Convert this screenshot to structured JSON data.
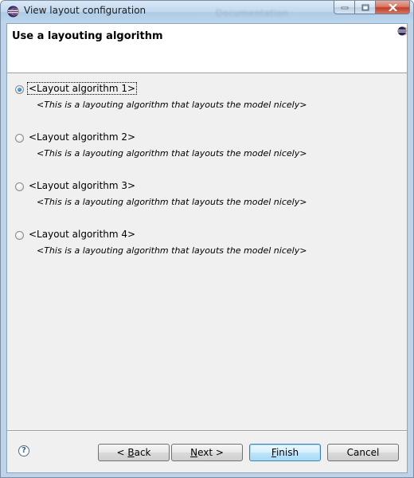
{
  "window": {
    "title": "View layout configuration",
    "ghost_title": "Documentation"
  },
  "header": {
    "title": "Use a layouting algorithm"
  },
  "options": [
    {
      "label": "<Layout algorithm 1>",
      "description": "<This is a layouting algorithm that layouts the model nicely>",
      "selected": true
    },
    {
      "label": "<Layout algorithm 2>",
      "description": "<This is a layouting algorithm that layouts the model nicely>",
      "selected": false
    },
    {
      "label": "<Layout algorithm 3>",
      "description": "<This is a layouting algorithm that layouts the model nicely>",
      "selected": false
    },
    {
      "label": "<Layout algorithm 4>",
      "description": "<This is a layouting algorithm that layouts the model nicely>",
      "selected": false
    }
  ],
  "buttons": {
    "help": "?",
    "back_prefix": "< ",
    "back_mnemonic": "B",
    "back_rest": "ack",
    "next_mnemonic": "N",
    "next_rest": "ext >",
    "finish_mnemonic": "F",
    "finish_rest": "inish",
    "cancel": "Cancel"
  },
  "colors": {
    "titlebar": "#c2d8ee",
    "dialog_bg": "#f0f0f0",
    "default_button": "#bee6fd",
    "close_button": "#c2402a"
  },
  "icons": {
    "app": "eclipse-icon",
    "header": "eclipse-small-icon",
    "minimize": "minimize-icon",
    "maximize": "maximize-icon",
    "close": "close-icon",
    "help": "help-icon"
  }
}
